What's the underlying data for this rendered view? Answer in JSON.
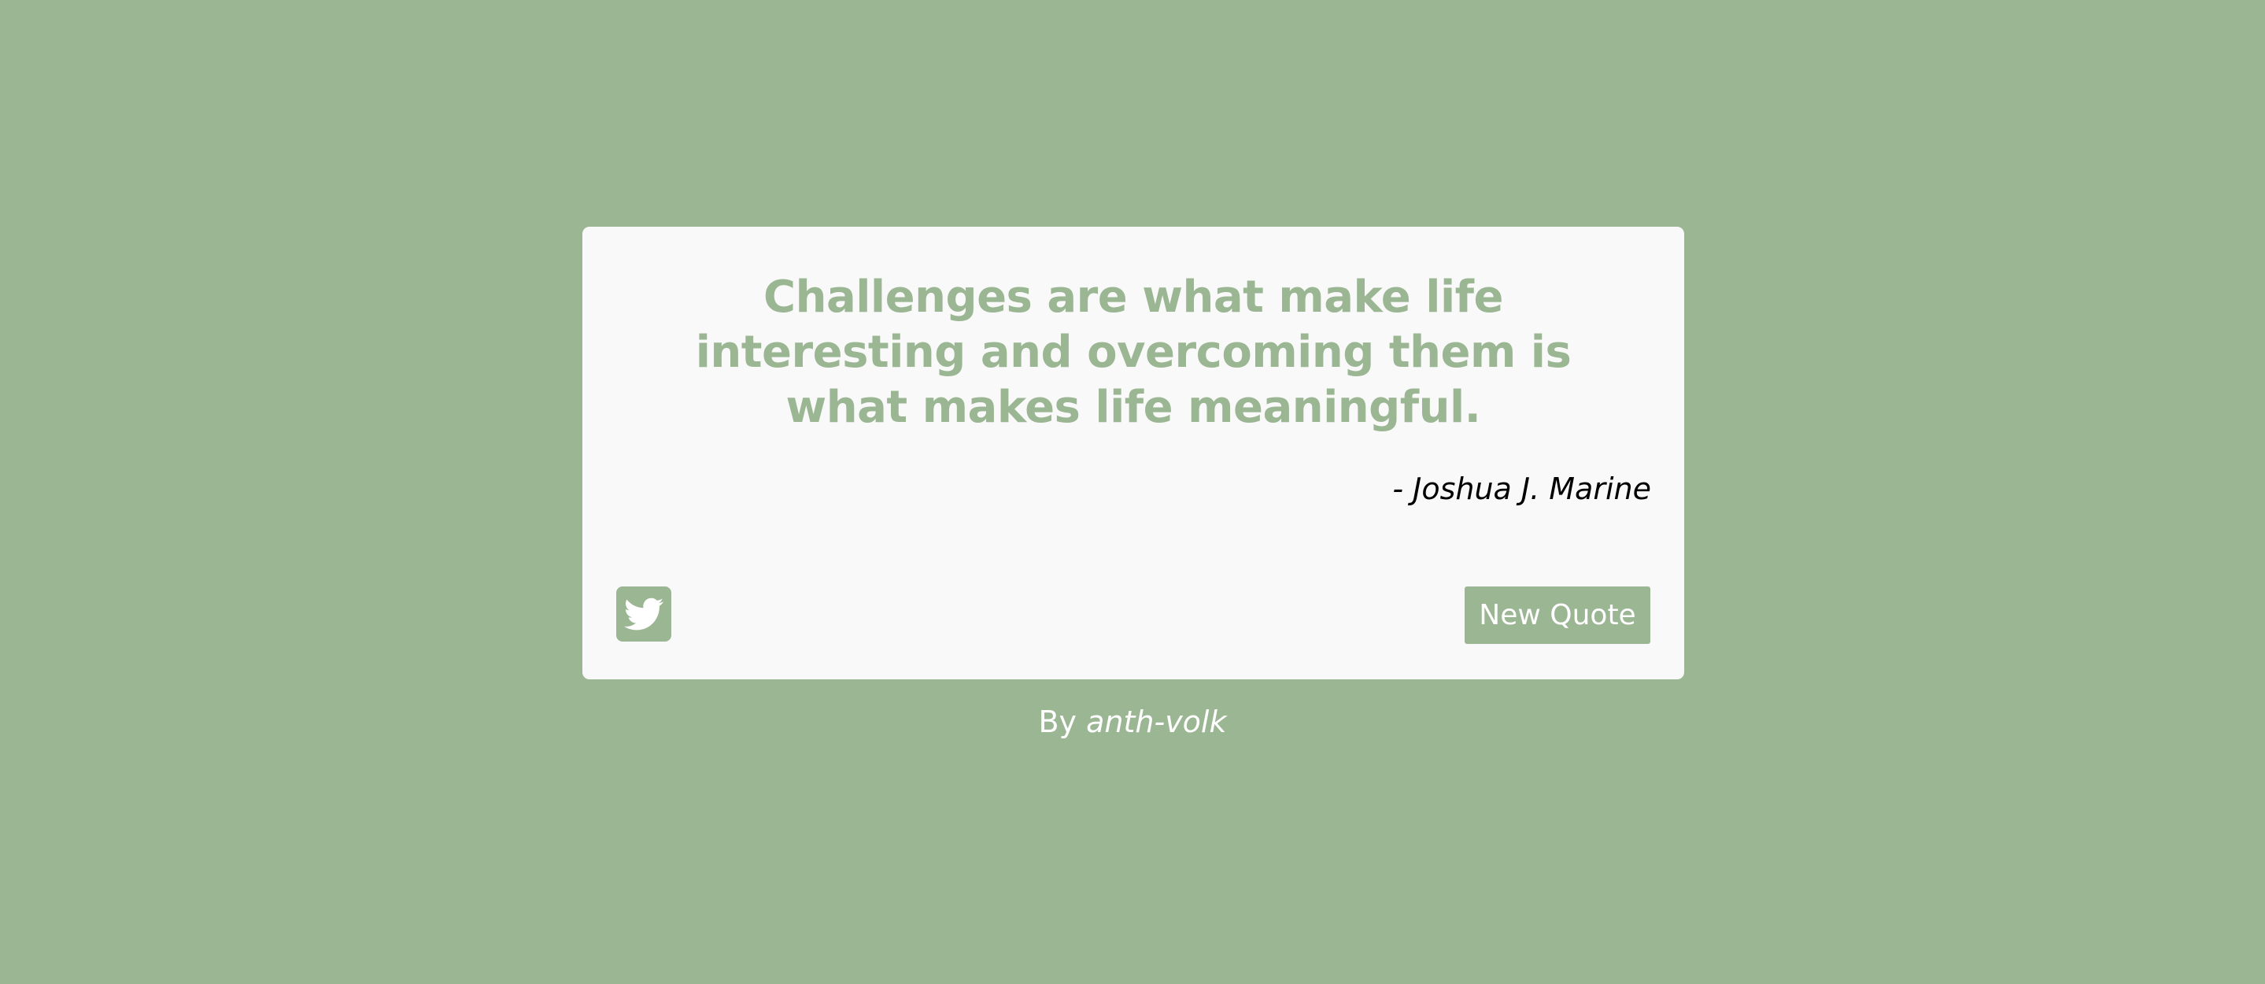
{
  "colors": {
    "background": "#9bb693",
    "card": "#f9f9f9",
    "accent": "#9bb693",
    "author_text": "#000000",
    "credit_text": "#ffffff"
  },
  "quote": {
    "text": "Challenges are what make life interesting and overcoming them is what makes life meaningful.",
    "author": "- Joshua J. Marine"
  },
  "actions": {
    "tweet_icon": "twitter-icon",
    "new_quote_label": "New Quote"
  },
  "credit": {
    "prefix": "By ",
    "author_link": "anth-volk"
  }
}
